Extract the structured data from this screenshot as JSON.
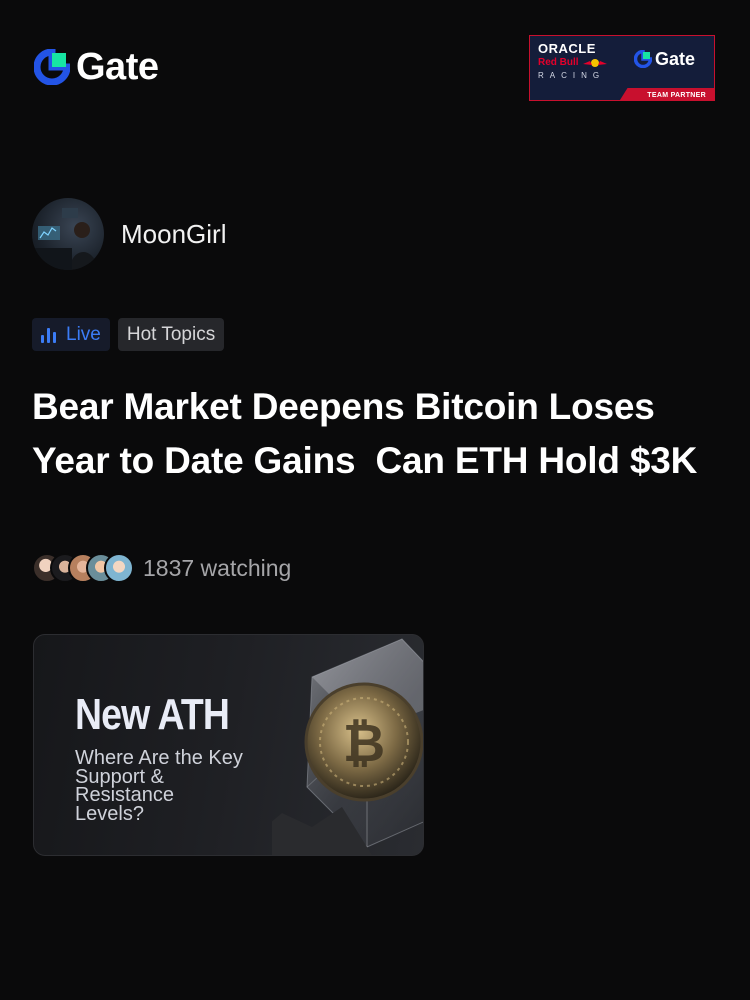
{
  "brand": {
    "name": "Gate"
  },
  "partner_badge": {
    "oracle": "ORACLE",
    "red_bull": "Red Bull",
    "racing": "RACING",
    "gate": "Gate",
    "team_partner": "TEAM PARTNER"
  },
  "author": {
    "name": "MoonGirl"
  },
  "tags": {
    "live": "Live",
    "hot": "Hot Topics"
  },
  "post": {
    "title": "Bear Market Deepens Bitcoin Loses Year to Date Gains  Can ETH Hold $3K",
    "watching": "1837 watching"
  },
  "banner": {
    "title": "New ATH",
    "subtitle": "Where Are the Key Support & Resistance Levels?"
  },
  "colors": {
    "background": "#0a0a0b",
    "brand_blue": "#2354e6",
    "brand_green": "#17e5a3",
    "live_blue": "#3b7cf6",
    "partner_red": "#c8102e"
  }
}
